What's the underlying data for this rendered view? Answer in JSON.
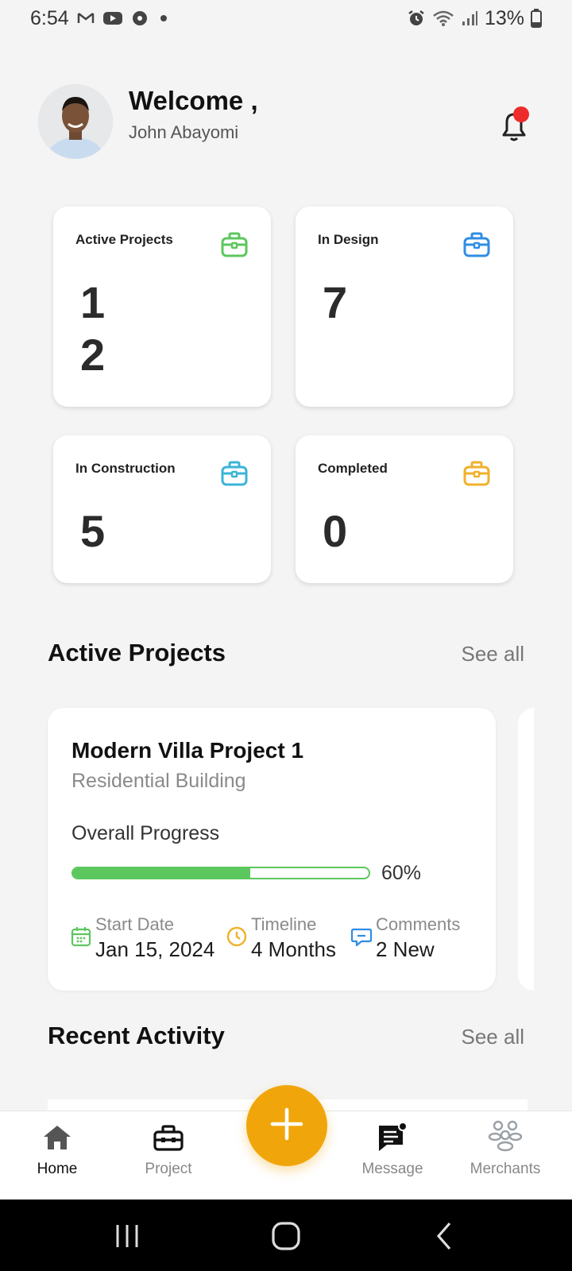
{
  "status_bar": {
    "time": "6:54",
    "battery": "13%",
    "left_icons": [
      "gmail-icon",
      "youtube-icon",
      "soccer-ball-icon",
      "dot-icon"
    ],
    "right_icons": [
      "alarm-icon",
      "wifi-icon",
      "signal-icon",
      "battery-charging-icon"
    ]
  },
  "header": {
    "greeting": "Welcome ,",
    "user_name": "John Abayomi",
    "notification_badge": true
  },
  "stats": [
    {
      "title": "Active Projects",
      "value": "1\n2",
      "icon": "briefcase-icon",
      "color": "#5cc75e"
    },
    {
      "title": "In Design",
      "value": "7",
      "icon": "briefcase-icon",
      "color": "#2f8de4"
    },
    {
      "title": "In Construction",
      "value": "5",
      "icon": "briefcase-icon",
      "color": "#3bb4d8"
    },
    {
      "title": "Completed",
      "value": "0",
      "icon": "briefcase-icon",
      "color": "#f0b12b"
    }
  ],
  "active_projects": {
    "title": "Active Projects",
    "see_all": "See all",
    "project": {
      "name": "Modern Villa Project 1",
      "type": "Residential Building",
      "progress_label": "Overall Progress",
      "progress": 0.6,
      "progress_text": "60%",
      "start_label": "Start Date",
      "start_value": "Jan 15, 2024",
      "timeline_label": "Timeline",
      "timeline_value": "4 Months",
      "comments_label": "Comments",
      "comments_value": "2 New"
    }
  },
  "recent_activity": {
    "title": "Recent Activity",
    "see_all": "See all"
  },
  "bottom_nav": {
    "home": "Home",
    "project": "Project",
    "message": "Message",
    "merchants": "Merchants",
    "active": "home"
  },
  "colors": {
    "accent": "#f0a60b",
    "progress": "#5cc75e",
    "badge": "#ee2b2b"
  }
}
